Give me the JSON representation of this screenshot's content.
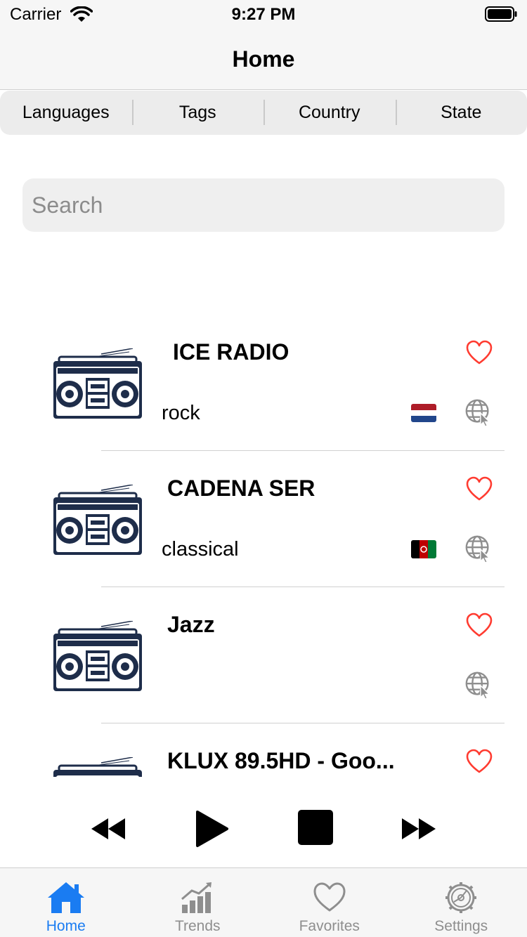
{
  "status_bar": {
    "carrier": "Carrier",
    "time": "9:27 PM"
  },
  "nav": {
    "title": "Home"
  },
  "segments": [
    {
      "label": "Languages"
    },
    {
      "label": "Tags"
    },
    {
      "label": "Country"
    },
    {
      "label": "State"
    }
  ],
  "search": {
    "placeholder": "Search"
  },
  "stations": [
    {
      "name": "ICE RADIO",
      "genre": "rock",
      "flag": "netherlands"
    },
    {
      "name": "CADENA SER",
      "genre": "classical",
      "flag": "afghanistan"
    },
    {
      "name": "Jazz",
      "genre": "",
      "flag": ""
    },
    {
      "name": "KLUX 89.5HD - Goo...",
      "genre": "",
      "flag": ""
    }
  ],
  "player": {
    "controls": [
      "rewind-icon",
      "play-icon",
      "stop-icon",
      "fast-forward-icon"
    ]
  },
  "tabs": [
    {
      "label": "Home",
      "icon": "house-icon",
      "active": true
    },
    {
      "label": "Trends",
      "icon": "chart-icon",
      "active": false
    },
    {
      "label": "Favorites",
      "icon": "heart-icon",
      "active": false
    },
    {
      "label": "Settings",
      "icon": "gear-icon",
      "active": false
    }
  ],
  "colors": {
    "accent": "#1a7cf2",
    "favorite": "#ff3b30",
    "inactive": "#8e8e8e",
    "boombox": "#1e2d4a"
  }
}
